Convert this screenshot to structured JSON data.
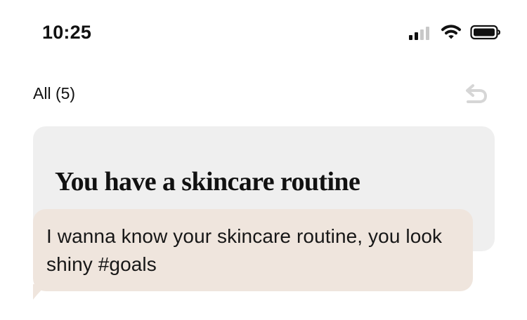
{
  "status_bar": {
    "time": "10:25",
    "icons": [
      "signal-icon",
      "wifi-icon",
      "battery-icon"
    ]
  },
  "header": {
    "filter_label": "All (5)",
    "reply_icon": "reply-arrow-icon"
  },
  "prompt_card": {
    "title": "You have a skincare routine"
  },
  "message": {
    "text": "I wanna know your skincare routine, you look shiny #goals"
  },
  "colors": {
    "card_background": "#efefef",
    "message_background": "#efe5dd",
    "text": "#111111",
    "muted_icon": "#d6d6d6"
  }
}
